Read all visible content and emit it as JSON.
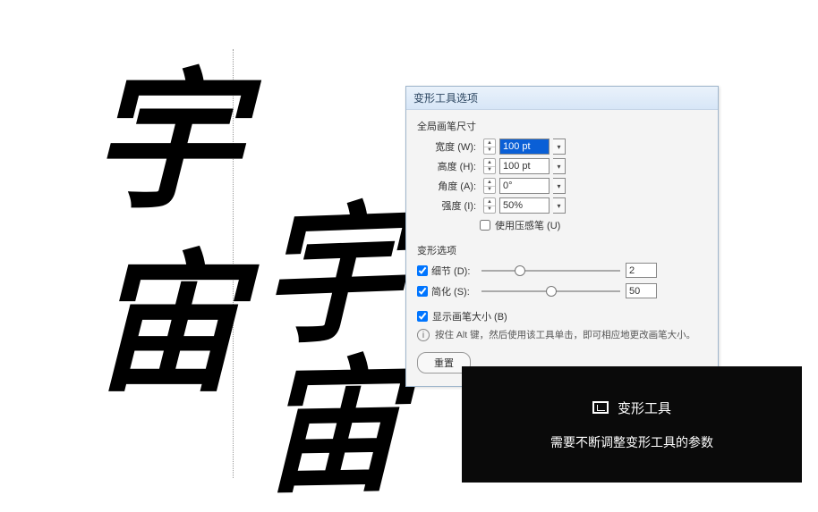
{
  "canvas": {
    "char1": "宇",
    "char2": "宙",
    "char3": "宇",
    "char4": "宙"
  },
  "dialog": {
    "title": "变形工具选项",
    "group_brush": "全局画笔尺寸",
    "width_label": "宽度 (W):",
    "width_value": "100 pt",
    "height_label": "高度 (H):",
    "height_value": "100 pt",
    "angle_label": "角度 (A):",
    "angle_value": "0°",
    "intensity_label": "强度 (I):",
    "intensity_value": "50%",
    "use_pressure": "使用压感笔 (U)",
    "group_warp": "变形选项",
    "detail_label": "细节 (D):",
    "detail_value": "2",
    "simplify_label": "简化 (S):",
    "simplify_value": "50",
    "show_brush": "显示画笔大小 (B)",
    "tip_text": "按住 Alt 键，然后使用该工具单击，即可相应地更改画笔大小。",
    "reset": "重置"
  },
  "tooltip": {
    "title": "变形工具",
    "desc": "需要不断调整变形工具的参数"
  }
}
